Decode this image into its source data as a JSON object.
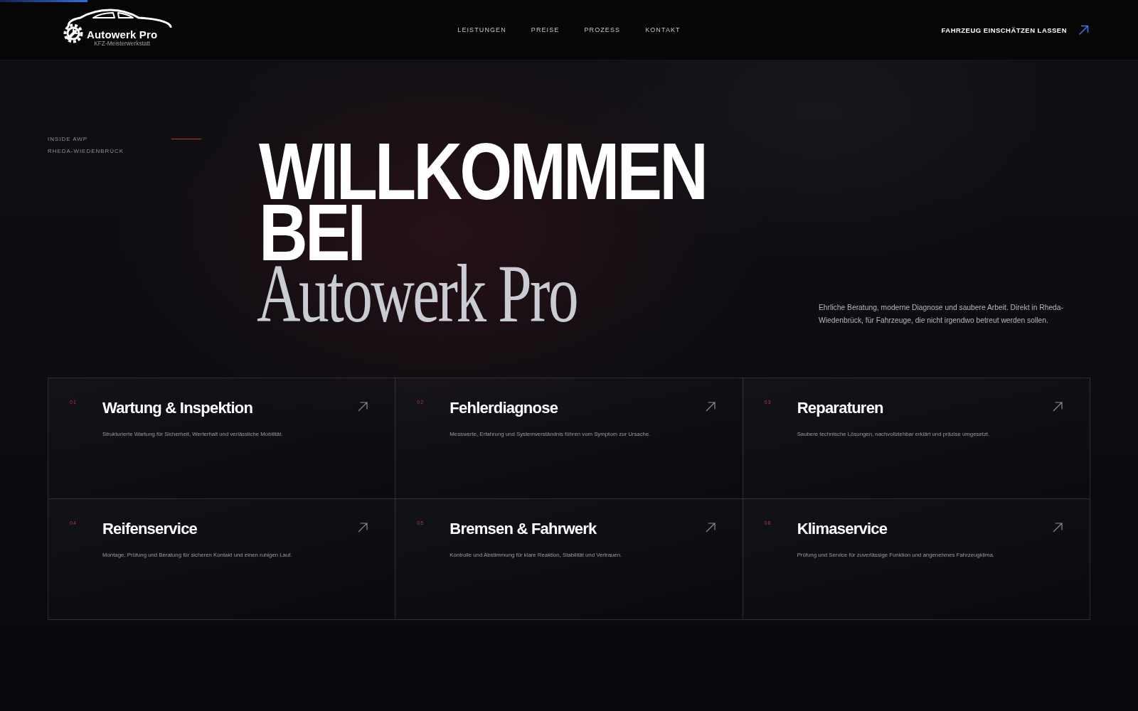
{
  "progress_bar": {
    "level": 0.077
  },
  "header": {
    "brand": {
      "name": "Autowerk Pro",
      "tagline": "KFZ-Meisterwerkstatt"
    },
    "nav": [
      {
        "label": "LEISTUNGEN"
      },
      {
        "label": "PREISE"
      },
      {
        "label": "PROZESS"
      },
      {
        "label": "KONTAKT"
      }
    ],
    "cta": {
      "label": "FAHRZEUG EINSCHÄTZEN LASSEN"
    }
  },
  "hero": {
    "eyebrow": [
      "INSIDE AWP",
      "RHEDA-WIEDENBRÜCK"
    ],
    "heading": "WILLKOMMEN BEI",
    "heading_brand": "Autowerk Pro",
    "intro": "Ehrliche Beratung, moderne Diagnose und saubere Arbeit. Direkt in Rheda-Wiedenbrück, für Fahrzeuge, die nicht irgendwo betreut werden sollen."
  },
  "services": [
    {
      "number": "01",
      "title": "Wartung & Inspektion",
      "text": "Strukturierte Wartung für Sicherheit, Werterhalt und verlässliche Mobilität."
    },
    {
      "number": "02",
      "title": "Fehlerdiagnose",
      "text": "Messwerte, Erfahrung und Systemverständnis führen vom Symptom zur Ursache."
    },
    {
      "number": "03",
      "title": "Reparaturen",
      "text": "Saubere technische Lösungen, nachvollziehbar erklärt und präzise umgesetzt."
    },
    {
      "number": "04",
      "title": "Reifenservice",
      "text": "Montage, Prüfung und Beratung für sicheren Kontakt und einen ruhigen Lauf."
    },
    {
      "number": "05",
      "title": "Bremsen & Fahrwerk",
      "text": "Kontrolle und Abstimmung für klare Reaktion, Stabilität und Vertrauen."
    },
    {
      "number": "06",
      "title": "Klimaservice",
      "text": "Prüfung und Service für zuverlässige Funktion und angenehmes Fahrzeugklima."
    }
  ]
}
